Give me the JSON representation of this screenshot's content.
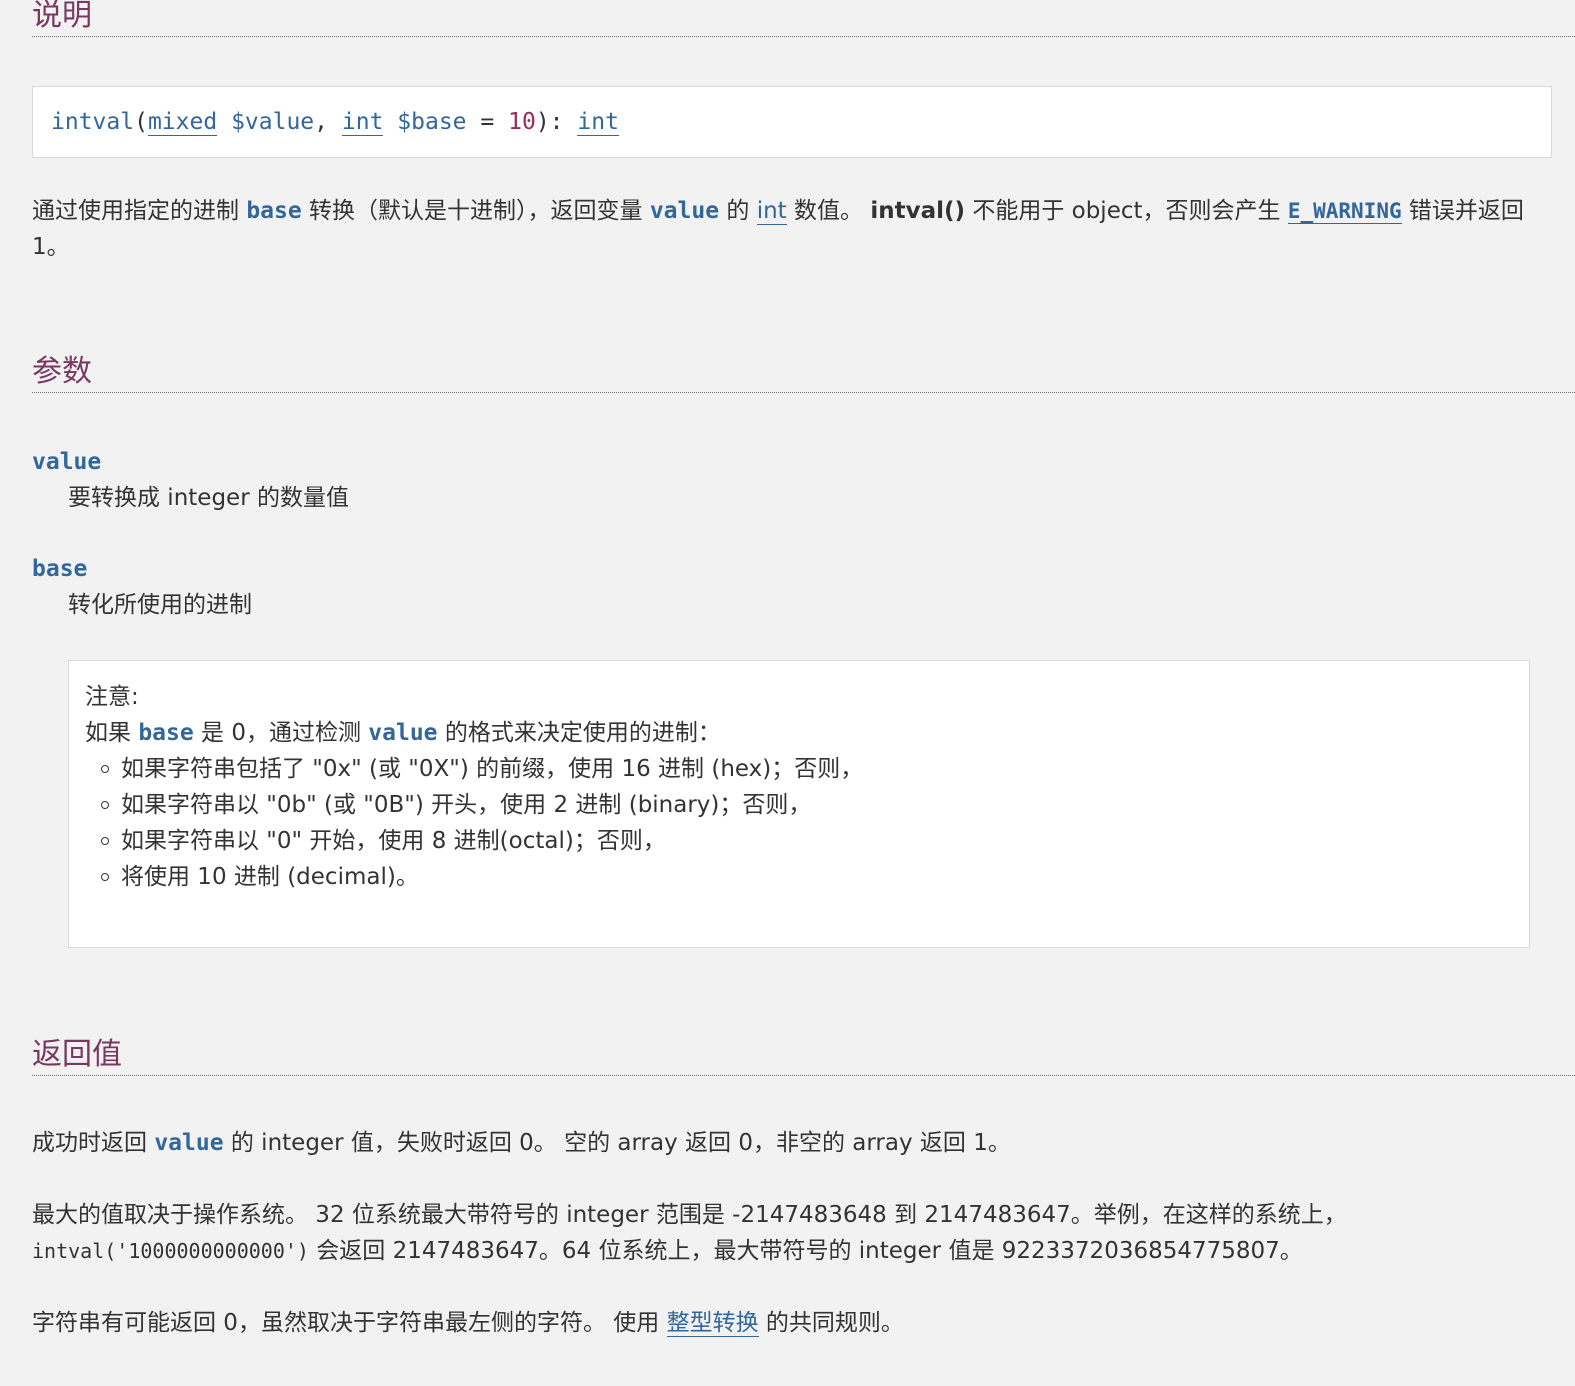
{
  "sections": {
    "description": "说明",
    "parameters": "参数",
    "returns": "返回值"
  },
  "signature": {
    "func": "intval",
    "open": "(",
    "type1": "mixed",
    "var1": "$value",
    "comma": ",",
    "type2": "int",
    "var2": "$base",
    "eq": "=",
    "default": "10",
    "close": "):",
    "ret_type": "int"
  },
  "description": {
    "t1": "通过使用指定的进制 ",
    "p_base": "base",
    "t2": " 转换（默认是十进制），返回变量 ",
    "p_value": "value",
    "t3": " 的 ",
    "link_int": "int",
    "t4": " 数值。 ",
    "func_bold": "intval()",
    "t5": " 不能用于 object，否则会产生 ",
    "link_warning": "E_WARNING",
    "t6": " 错误并返回 1。"
  },
  "params": [
    {
      "name": "value",
      "desc": "要转换成 integer 的数量值"
    },
    {
      "name": "base",
      "desc": "转化所使用的进制"
    }
  ],
  "note": {
    "title": "注意:",
    "l1": "如果 ",
    "p_base": "base",
    "l2": " 是 0，通过检测 ",
    "p_value": "value",
    "l3": " 的格式来决定使用的进制：",
    "items": [
      "如果字符串包括了 \"0x\" (或 \"0X\") 的前缀，使用 16 进制 (hex)；否则，",
      "如果字符串以 \"0b\" (或 \"0B\") 开头，使用 2 进制 (binary)；否则，",
      "如果字符串以 \"0\" 开始，使用 8 进制(octal)；否则，",
      "将使用 10 进制 (decimal)。"
    ]
  },
  "returns": {
    "r1": "成功时返回 ",
    "p_value": "value",
    "r2": " 的 integer 值，失败时返回 0。 空的 array 返回 0，非空的 array 返回 1。",
    "max1": "最大的值取决于操作系统。 32 位系统最大带符号的 integer 范围是 -2147483648 到 2147483647。举例，在这样的系统上，",
    "code": "intval('1000000000000')",
    "max2": " 会返回 2147483647。64 位系统上，最大带符号的 integer 值是 9223372036854775807。",
    "str1": "字符串有可能返回 0，虽然取决于字符串最左侧的字符。 使用 ",
    "link_conv": "整型转换",
    "str2": " 的共同规则。"
  }
}
